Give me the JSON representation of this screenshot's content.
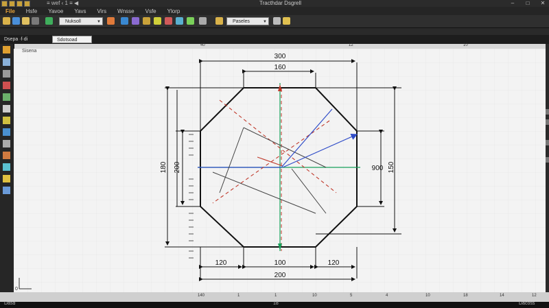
{
  "window": {
    "app_title": "≡ wef ‹ 1 ≡ ◀",
    "title": "Tracthdar Dsgrell"
  },
  "menu": [
    "File",
    "Hsfe",
    "Yavoe",
    "Yavs",
    "Virs",
    "Wnsse",
    "Vsfe",
    "Ylorp"
  ],
  "toolbar": {
    "layer_box": "Nuksoll",
    "style_box": "Paseles"
  },
  "tabs": {
    "tab1": "Dsepa ·f·di",
    "tab2": "Sdotsoad"
  },
  "canvas": {
    "label": "Sisena"
  },
  "ruler_top": [
    "40",
    "12",
    "10"
  ],
  "status": [
    "140",
    "1",
    "1",
    "10",
    "5",
    "4",
    "10",
    "18",
    "14",
    "12"
  ],
  "bottom": {
    "left": "Dasd",
    "middle": "18",
    "right": "Dacoss"
  },
  "cursor": "0",
  "drawing": {
    "dims": {
      "top_outer": "300",
      "top_inner": "160",
      "left_outer": "180",
      "left_inner": "200",
      "right_inner": "900",
      "right_outer": "150",
      "bottom_left": "120",
      "bottom_mid": "100",
      "bottom_right": "120",
      "bottom_total": "200"
    }
  },
  "colors": {
    "accent": "#e8a33a",
    "canvas": "#f3f3f3",
    "green_axis": "#17a05a",
    "red_axis": "#c0392b",
    "blue_axis": "#2f4cc8"
  }
}
